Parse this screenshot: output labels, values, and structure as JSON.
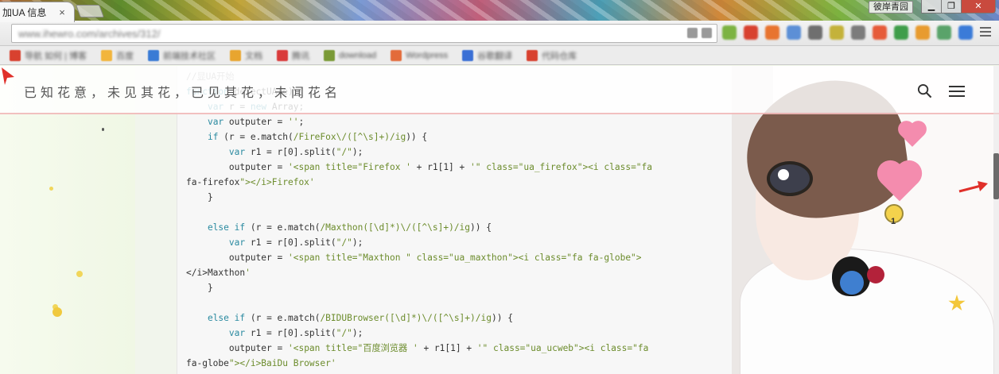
{
  "browser": {
    "tab_title": "加UA 信息",
    "tab_close": "×",
    "profile_name": "彼岸青园",
    "window_controls": {
      "minimize": "▁",
      "maximize": "❐",
      "close": "✕"
    },
    "url": "www.ihewro.com/archives/312/",
    "bookmarks": [
      {
        "label": "导航 如何 | 博客",
        "color": "#d8412f"
      },
      {
        "label": "百度",
        "color": "#f2b53c"
      },
      {
        "label": "前端技术社区",
        "color": "#3a7bd5"
      },
      {
        "label": "文档",
        "color": "#e8a52f"
      },
      {
        "label": "腾讯",
        "color": "#d93b3b"
      },
      {
        "label": "download",
        "color": "#7a9a36"
      },
      {
        "label": "Wordpress",
        "color": "#e36b3a"
      },
      {
        "label": "谷歌翻译",
        "color": "#3a6fd5"
      },
      {
        "label": "代码仓库",
        "color": "#d8412f"
      }
    ],
    "extension_colors": [
      "#7cb342",
      "#d8412f",
      "#e8742f",
      "#5c8fd6",
      "#6f6f6f",
      "#c4b23a",
      "#7c7c7c",
      "#e65b3a",
      "#3f9d4a",
      "#e89b2f",
      "#5aa36a",
      "#3b7bd8"
    ]
  },
  "site": {
    "title": "已知花意，未见其花，已见其花，未闻花名",
    "search_icon": "search-icon",
    "menu_icon": "hamburger-icon"
  },
  "code_lines": [
    "//显UA开始",
    "function detectUA(e) {",
    "    var r = new Array;",
    "    var outputer = '';",
    "    if (r = e.match(/FireFox\\/([^\\s]+)/ig)) {",
    "        var r1 = r[0].split(\"/\");",
    "        outputer = '<span title=\"Firefox ' + r1[1] + '\" class=\"ua_firefox\"><i class=\"fa",
    "fa-firefox\"></i>Firefox'",
    "    }",
    "",
    "    else if (r = e.match(/Maxthon([\\d]*)\\/([^\\s]+)/ig)) {",
    "        var r1 = r[0].split(\"/\");",
    "        outputer = '<span title=\"Maxthon \" class=\"ua_maxthon\"><i class=\"fa fa-globe\">",
    "</i>Maxthon'",
    "    }",
    "",
    "    else if (r = e.match(/BIDUBrowser([\\d]*)\\/([^\\s]+)/ig)) {",
    "        var r1 = r[0].split(\"/\");",
    "        outputer = '<span title=\"百度浏览器 ' + r1[1] + '\" class=\"ua_ucweb\"><i class=\"fa",
    "fa-globe\"></i>BaiDu Browser'"
  ],
  "art": {
    "bulb_count": "1"
  }
}
